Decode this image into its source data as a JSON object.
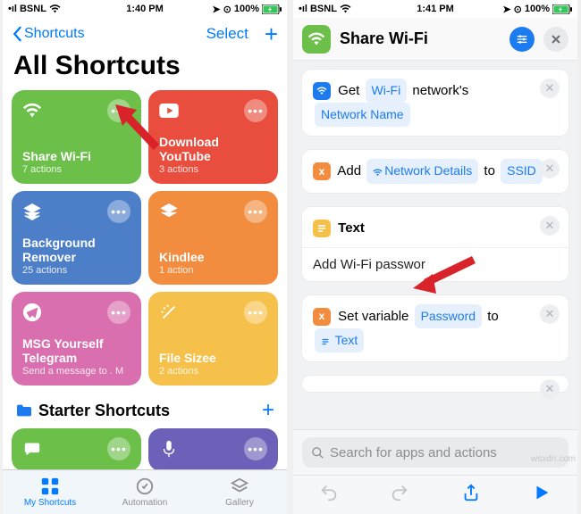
{
  "left": {
    "status": {
      "carrier": "BSNL",
      "time": "1:40 PM",
      "battery": "100%"
    },
    "nav": {
      "back": "Shortcuts",
      "select": "Select",
      "plus": "+"
    },
    "title": "All Shortcuts",
    "tiles": [
      {
        "name": "Share Wi-Fi",
        "sub": "7 actions"
      },
      {
        "name": "Download YouTube",
        "sub": "3 actions"
      },
      {
        "name": "Background Remover",
        "sub": "25 actions"
      },
      {
        "name": "Kindlee",
        "sub": "1 action"
      },
      {
        "name": "MSG Yourself Telegram",
        "sub": "Send a message to . M"
      },
      {
        "name": "File Sizee",
        "sub": "2 actions"
      }
    ],
    "section": {
      "label": "Starter Shortcuts",
      "plus": "+"
    },
    "tabs": {
      "my": "My Shortcuts",
      "auto": "Automation",
      "gallery": "Gallery"
    }
  },
  "right": {
    "status": {
      "carrier": "BSNL",
      "time": "1:41 PM",
      "battery": "100%"
    },
    "header": {
      "title": "Share Wi-Fi"
    },
    "actions": {
      "a1": {
        "pre": "Get",
        "token": "Wi-Fi",
        "mid": "network's",
        "token2": "Network Name"
      },
      "a2": {
        "pre": "Add",
        "token": "Network Details",
        "post": "to",
        "dest": "SSID"
      },
      "a3": {
        "label": "Text",
        "value": "Add Wi-Fi passwor"
      },
      "a4": {
        "pre": "Set variable",
        "var": "Password",
        "post": "to",
        "dest": "Text"
      }
    },
    "search": {
      "placeholder": "Search for apps and actions"
    }
  },
  "watermark": "wsxdn.com"
}
